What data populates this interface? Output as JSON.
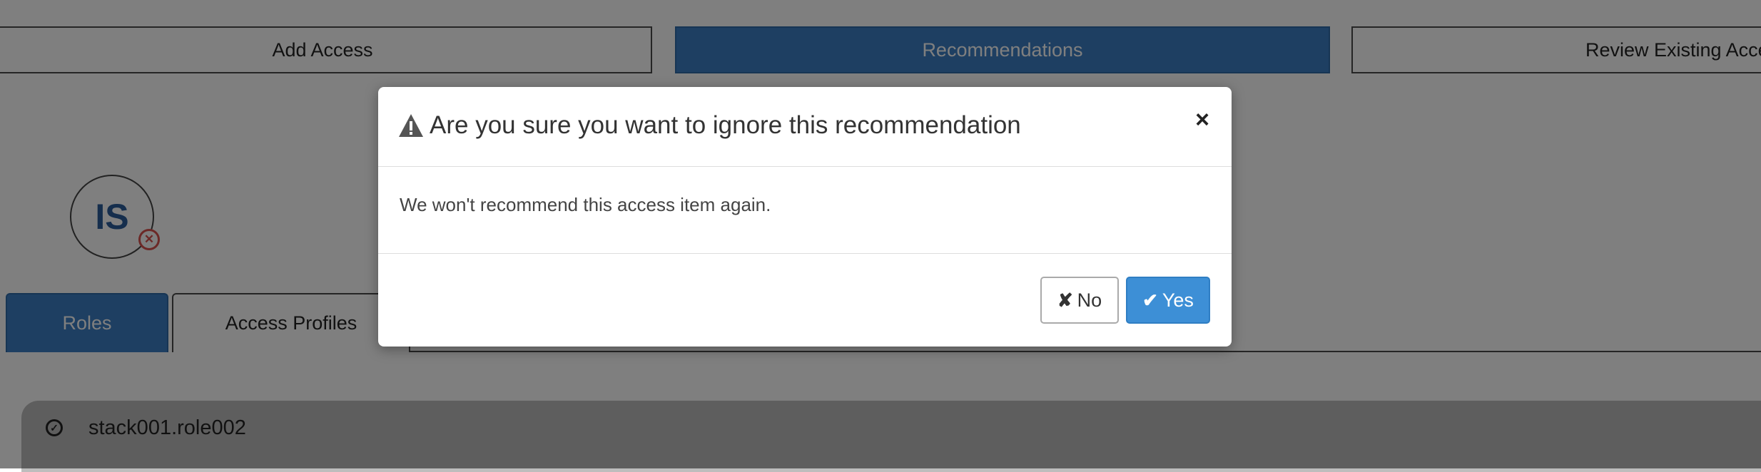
{
  "top_tabs": {
    "add_access": "Add Access",
    "recommendations": "Recommendations",
    "review_existing_access": "Review Existing Acces"
  },
  "identity": {
    "initials": "IS",
    "badge_icon": "circle-x-icon"
  },
  "sub_tabs": {
    "roles": "Roles",
    "access_profiles": "Access Profiles"
  },
  "list": {
    "items": [
      {
        "label": "stack001.role002",
        "icon": "circle-check-icon"
      }
    ]
  },
  "dialog": {
    "title": "Are you sure you want to ignore this recommendation",
    "title_icon": "warning-icon",
    "close_glyph": "×",
    "message": "We won't recommend this access item again.",
    "no_label": "No",
    "no_glyph": "✘",
    "yes_label": "Yes",
    "yes_glyph": "✔"
  },
  "colors": {
    "primary": "#3d7fc4",
    "overlay": "rgba(0,0,0,0.5)",
    "danger": "#d9534f"
  }
}
